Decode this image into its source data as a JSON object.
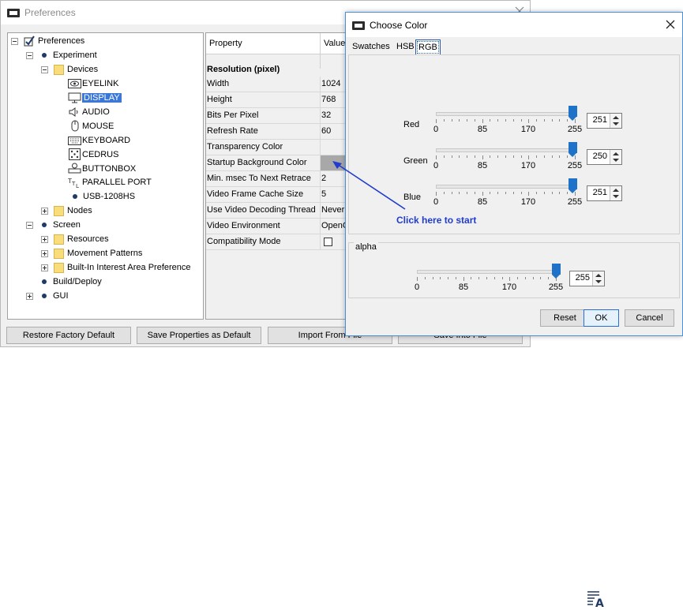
{
  "preferences": {
    "title": "Preferences",
    "tree": [
      {
        "label": "Preferences"
      },
      {
        "label": "Experiment"
      },
      {
        "label": "Devices"
      },
      {
        "label": "EYELINK"
      },
      {
        "label": "DISPLAY"
      },
      {
        "label": "AUDIO"
      },
      {
        "label": "MOUSE"
      },
      {
        "label": "KEYBOARD"
      },
      {
        "label": "CEDRUS"
      },
      {
        "label": "BUTTONBOX"
      },
      {
        "label": "PARALLEL PORT"
      },
      {
        "label": "USB-1208HS"
      },
      {
        "label": "Nodes"
      },
      {
        "label": "Screen"
      },
      {
        "label": "Resources"
      },
      {
        "label": "Movement Patterns"
      },
      {
        "label": "Built-In Interest Area Preference"
      },
      {
        "label": "Build/Deploy"
      },
      {
        "label": "GUI"
      }
    ],
    "table": {
      "headers": [
        "Property",
        "Value"
      ],
      "section": "Resolution (pixel)",
      "rows": [
        {
          "property": "Width",
          "value": "1024"
        },
        {
          "property": "Height",
          "value": "768"
        },
        {
          "property": "Bits Per Pixel",
          "value": "32"
        },
        {
          "property": "Refresh Rate",
          "value": "60"
        },
        {
          "property": "Transparency Color",
          "value": ""
        },
        {
          "property": "Startup Background Color",
          "value": ""
        },
        {
          "property": "Min. msec To Next Retrace",
          "value": "2"
        },
        {
          "property": "Video Frame Cache Size",
          "value": "5"
        },
        {
          "property": "Use Video Decoding Thread",
          "value": "Never"
        },
        {
          "property": "Video Environment",
          "value": "OpenG"
        },
        {
          "property": "Compatibility Mode",
          "value": ""
        }
      ]
    },
    "buttons": {
      "restore": "Restore Factory Default",
      "save_default": "Save Properties as Default",
      "import": "Import From File",
      "save_file": "Save Into File"
    }
  },
  "color_dialog": {
    "title": "Choose Color",
    "tabs": [
      "Swatches",
      "HSB",
      "RGB"
    ],
    "active_tab": "RGB",
    "tick_labels": [
      "0",
      "85",
      "170",
      "255"
    ],
    "channels": [
      {
        "name": "Red",
        "value": "251"
      },
      {
        "name": "Green",
        "value": "250"
      },
      {
        "name": "Blue",
        "value": "251"
      }
    ],
    "alpha": {
      "label": "alpha",
      "value": "255"
    },
    "buttons": {
      "reset": "Reset",
      "ok": "OK",
      "cancel": "Cancel"
    }
  },
  "annotation": {
    "text": "Click here to start",
    "color": "#1f3ccf"
  },
  "colors": {
    "accent": "#1e72c8",
    "selection": "#3a77d6",
    "swatch": "#a8a8a8"
  }
}
